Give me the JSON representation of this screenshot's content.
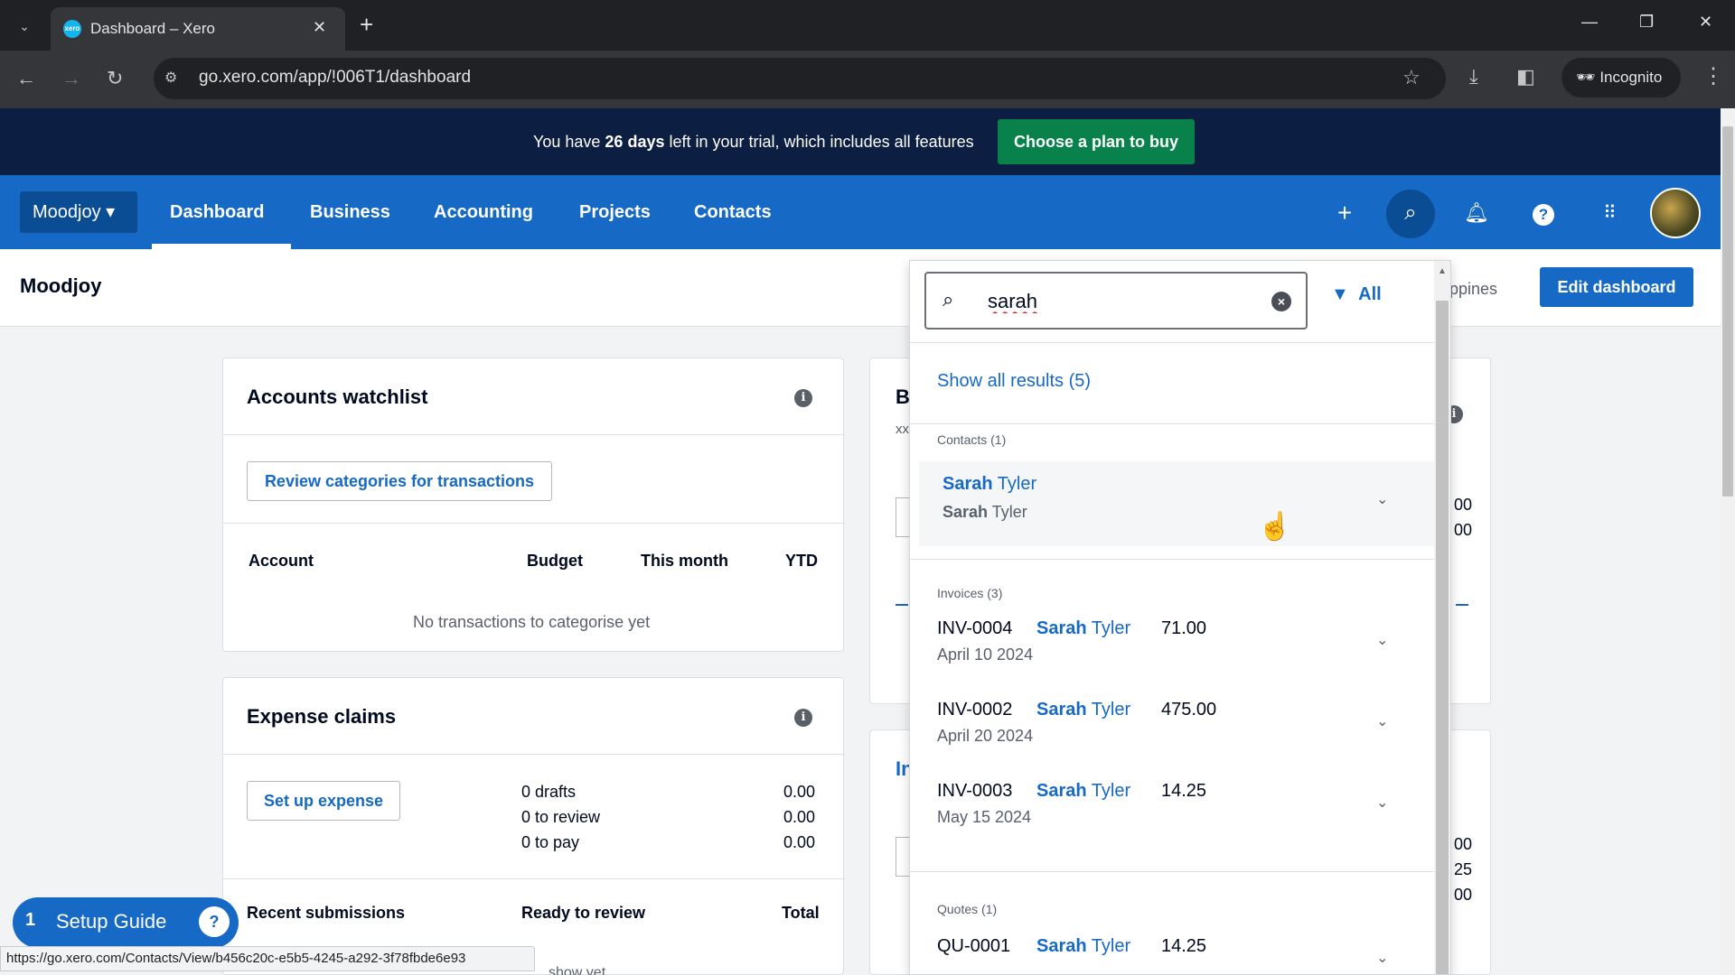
{
  "browser": {
    "tab_title": "Dashboard – Xero",
    "favicon_text": "xero",
    "url": "go.xero.com/app/!006T1/dashboard",
    "incognito_label": "Incognito",
    "status_url": "https://go.xero.com/Contacts/View/b456c20c-e5b5-4245-a292-3f78fbde6e93"
  },
  "trial": {
    "text_before": "You have ",
    "days": "26 days",
    "text_after": " left in your trial, which includes all features",
    "cta": "Choose a plan to buy"
  },
  "nav": {
    "org": "Moodjoy",
    "items": [
      "Dashboard",
      "Business",
      "Accounting",
      "Projects",
      "Contacts"
    ],
    "active": "Dashboard"
  },
  "page": {
    "org_title": "Moodjoy",
    "partial_text": "ippines",
    "edit_dashboard": "Edit dashboard"
  },
  "watchlist": {
    "title": "Accounts watchlist",
    "review_button": "Review categories for transactions",
    "columns": [
      "Account",
      "Budget",
      "This month",
      "YTD"
    ],
    "empty": "No transactions to categorise yet"
  },
  "expense": {
    "title": "Expense claims",
    "setup_button": "Set up expense",
    "rows": [
      {
        "label": "0 drafts",
        "value": "0.00"
      },
      {
        "label": "0 to review",
        "value": "0.00"
      },
      {
        "label": "0 to pay",
        "value": "0.00"
      }
    ],
    "columns": [
      "Recent submissions",
      "Ready to review",
      "Total"
    ],
    "partial_text": "show yet"
  },
  "bg_card": {
    "title_partial": "B",
    "sub_partial": "xx",
    "title2_partial": "In",
    "vals_right": [
      "00",
      "00",
      "00",
      "25",
      "00"
    ]
  },
  "search": {
    "query": "sarah",
    "filter_label": "All",
    "show_all": "Show all results (5)",
    "contacts_label": "Contacts (1)",
    "contact": {
      "highlight": "Sarah",
      "rest": " Tyler",
      "sub_highlight": "Sarah",
      "sub_rest": " Tyler"
    },
    "invoices_label": "Invoices (3)",
    "invoices": [
      {
        "id": "INV-0004",
        "highlight": "Sarah",
        "rest": " Tyler",
        "amount": "71.00",
        "date": "April 10 2024"
      },
      {
        "id": "INV-0002",
        "highlight": "Sarah",
        "rest": " Tyler",
        "amount": "475.00",
        "date": "April 20 2024"
      },
      {
        "id": "INV-0003",
        "highlight": "Sarah",
        "rest": " Tyler",
        "amount": "14.25",
        "date": "May 15 2024"
      }
    ],
    "quotes_label": "Quotes (1)",
    "quote": {
      "id": "QU-0001",
      "highlight": "Sarah",
      "rest": " Tyler",
      "amount": "14.25"
    }
  },
  "setup_guide": {
    "count": "1",
    "label": "Setup Guide"
  },
  "icons": {
    "search": "search-icon",
    "bell": "bell-icon",
    "help": "help-icon",
    "apps": "apps-grid-icon",
    "add": "plus-icon",
    "filter": "filter-icon",
    "chevron": "chevron-down-icon"
  },
  "colors": {
    "brand_blue": "#1669c4",
    "trial_bg": "#0c1e42",
    "cta_green": "#09814a"
  }
}
